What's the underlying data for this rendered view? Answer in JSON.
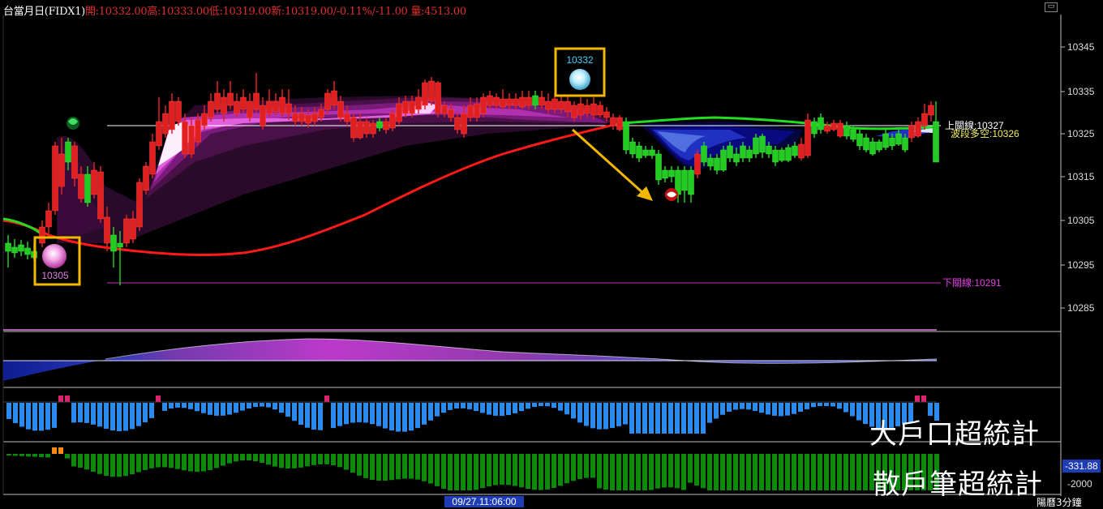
{
  "header": {
    "symbol": "台當月日(FIDX1)",
    "open_label": "開:",
    "open": "10332.00",
    "high_label": "高:",
    "high": "10333.00",
    "low_label": "低:",
    "low": "10319.00",
    "last_label": "新:",
    "last": "10319.00",
    "change_pct": "/-0.11%",
    "change": "/-11.00",
    "volume_label": "量:",
    "volume": "4513.00"
  },
  "price_axis": [
    "10345",
    "10335",
    "10325",
    "10315",
    "10305",
    "10295",
    "10285"
  ],
  "annotations": {
    "upper_line": "上關線:10327",
    "swing": "波段多空:10326",
    "lower_line": "下關線:10291",
    "peak_box": "10332",
    "trough_box": "10305"
  },
  "panels": {
    "big_player": "大戶口超統計",
    "retail": "散戶筆超統計",
    "retail_value": "-331.88",
    "retail_tick": "-2000"
  },
  "footer": {
    "time": "09/27.11:06:00",
    "period": "陽曆3分鐘"
  },
  "colors": {
    "up": "#e02020",
    "down": "#22cc22",
    "ma_red": "#ff1a1a",
    "ma_green": "#22dd22",
    "header_text": "#e03030",
    "symbol_text": "#ffffff",
    "box_border": "#f5b800",
    "purple": "#c030c0"
  },
  "icons": [
    "bull-icon-green",
    "pearl-icon-pink",
    "pearl-icon-blue",
    "bear-icon-red",
    "arrow-down-right-icon"
  ]
}
